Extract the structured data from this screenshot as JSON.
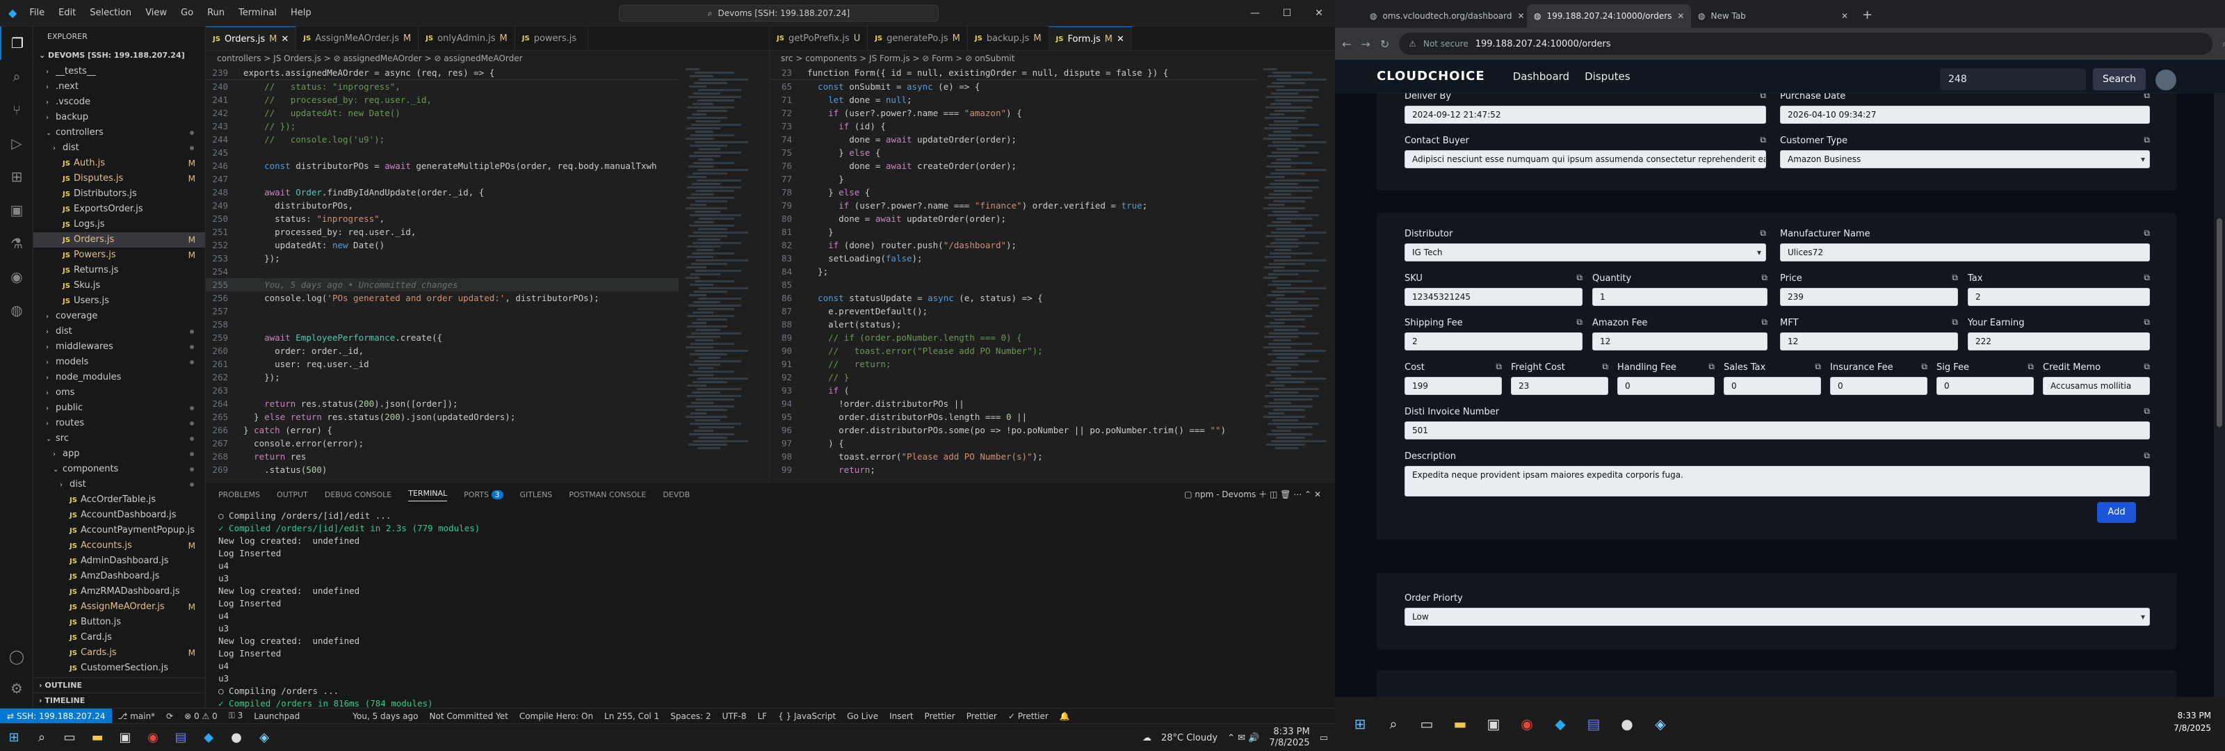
{
  "vscode": {
    "menu": [
      "File",
      "Edit",
      "Selection",
      "View",
      "Go",
      "Run",
      "Terminal",
      "Help"
    ],
    "command_center": "Devoms [SSH: 199.188.207.24]",
    "editor_tabs": [
      {
        "name": "Orders.js",
        "mark": "M",
        "active": true
      },
      {
        "name": "AssignMeAOrder.js",
        "mark": "M",
        "active": false
      },
      {
        "name": "onlyAdmin.js",
        "mark": "M",
        "active": false
      },
      {
        "name": "powers.js",
        "mark": "",
        "active": false
      }
    ],
    "editor2_tabs": [
      {
        "name": "getPoPrefix.js",
        "mark": "U",
        "active": false
      },
      {
        "name": "generatePo.js",
        "mark": "M",
        "active": false
      },
      {
        "name": "backup.js",
        "mark": "M",
        "active": false
      },
      {
        "name": "Form.js",
        "mark": "M",
        "active": true
      }
    ],
    "breadcrumb1": "controllers > JS Orders.js > ⊘ assignedMeAOrder > ⊘ assignedMeAOrder",
    "breadcrumb2": "src > components > JS Form.js > ⊘ Form > ⊘ onSubmit",
    "explorer_title": "EXPLORER",
    "explorer_root": "DEVOMS [SSH: 199.188.207.24]",
    "tree": [
      {
        "label": "__tests__",
        "depth": 1,
        "folder": true,
        "open": false,
        "badge": ""
      },
      {
        "label": ".next",
        "depth": 1,
        "folder": true,
        "open": false,
        "badge": ""
      },
      {
        "label": ".vscode",
        "depth": 1,
        "folder": true,
        "open": false,
        "badge": ""
      },
      {
        "label": "backup",
        "depth": 1,
        "folder": true,
        "open": false,
        "badge": ""
      },
      {
        "label": "controllers",
        "depth": 1,
        "folder": true,
        "open": true,
        "badge": "dot"
      },
      {
        "label": "dist",
        "depth": 2,
        "folder": true,
        "open": false,
        "badge": "dot"
      },
      {
        "label": "Auth.js",
        "depth": 2,
        "folder": false,
        "badge": "M"
      },
      {
        "label": "Disputes.js",
        "depth": 2,
        "folder": false,
        "badge": "M"
      },
      {
        "label": "Distributors.js",
        "depth": 2,
        "folder": false,
        "badge": ""
      },
      {
        "label": "ExportsOrder.js",
        "depth": 2,
        "folder": false,
        "badge": ""
      },
      {
        "label": "Logs.js",
        "depth": 2,
        "folder": false,
        "badge": ""
      },
      {
        "label": "Orders.js",
        "depth": 2,
        "folder": false,
        "badge": "M",
        "selected": true
      },
      {
        "label": "Powers.js",
        "depth": 2,
        "folder": false,
        "badge": "M"
      },
      {
        "label": "Returns.js",
        "depth": 2,
        "folder": false,
        "badge": ""
      },
      {
        "label": "Sku.js",
        "depth": 2,
        "folder": false,
        "badge": ""
      },
      {
        "label": "Users.js",
        "depth": 2,
        "folder": false,
        "badge": ""
      },
      {
        "label": "coverage",
        "depth": 1,
        "folder": true,
        "open": false,
        "badge": ""
      },
      {
        "label": "dist",
        "depth": 1,
        "folder": true,
        "open": false,
        "badge": "dot"
      },
      {
        "label": "middlewares",
        "depth": 1,
        "folder": true,
        "open": false,
        "badge": "dot"
      },
      {
        "label": "models",
        "depth": 1,
        "folder": true,
        "open": false,
        "badge": "dot"
      },
      {
        "label": "node_modules",
        "depth": 1,
        "folder": true,
        "open": false,
        "badge": ""
      },
      {
        "label": "oms",
        "depth": 1,
        "folder": true,
        "open": false,
        "badge": ""
      },
      {
        "label": "public",
        "depth": 1,
        "folder": true,
        "open": false,
        "badge": "dot"
      },
      {
        "label": "routes",
        "depth": 1,
        "folder": true,
        "open": false,
        "badge": "dot"
      },
      {
        "label": "src",
        "depth": 1,
        "folder": true,
        "open": true,
        "badge": "dot"
      },
      {
        "label": "app",
        "depth": 2,
        "folder": true,
        "open": false,
        "badge": "dot"
      },
      {
        "label": "components",
        "depth": 2,
        "folder": true,
        "open": true,
        "badge": "dot"
      },
      {
        "label": "dist",
        "depth": 3,
        "folder": true,
        "open": false,
        "badge": "dot"
      },
      {
        "label": "AccOrderTable.js",
        "depth": 3,
        "folder": false,
        "badge": ""
      },
      {
        "label": "AccountDashboard.js",
        "depth": 3,
        "folder": false,
        "badge": ""
      },
      {
        "label": "AccountPaymentPopup.js",
        "depth": 3,
        "folder": false,
        "badge": ""
      },
      {
        "label": "Accounts.js",
        "depth": 3,
        "folder": false,
        "badge": "M"
      },
      {
        "label": "AdminDashboard.js",
        "depth": 3,
        "folder": false,
        "badge": ""
      },
      {
        "label": "AmzDashboard.js",
        "depth": 3,
        "folder": false,
        "badge": ""
      },
      {
        "label": "AmzRMADashboard.js",
        "depth": 3,
        "folder": false,
        "badge": ""
      },
      {
        "label": "AssignMeAOrder.js",
        "depth": 3,
        "folder": false,
        "badge": "M"
      },
      {
        "label": "Button.js",
        "depth": 3,
        "folder": false,
        "badge": ""
      },
      {
        "label": "Card.js",
        "depth": 3,
        "folder": false,
        "badge": ""
      },
      {
        "label": "Cards.js",
        "depth": 3,
        "folder": false,
        "badge": "M"
      },
      {
        "label": "CustomerSection.js",
        "depth": 3,
        "folder": false,
        "badge": ""
      }
    ],
    "outline": "OUTLINE",
    "timeline": "TIMELINE",
    "code1": [
      {
        "n": "240",
        "t": "    //   status: \"inprogress\","
      },
      {
        "n": "241",
        "t": "    //   processed_by: req.user._id,"
      },
      {
        "n": "242",
        "t": "    //   updatedAt: new Date()"
      },
      {
        "n": "243",
        "t": "    // });"
      },
      {
        "n": "244",
        "t": "    //   console.log('u9');"
      },
      {
        "n": "245",
        "t": ""
      },
      {
        "n": "246",
        "t": "    const distributorPOs = await generateMultiplePOs(order, req.body.manualTxwh"
      },
      {
        "n": "247",
        "t": ""
      },
      {
        "n": "248",
        "t": "    await Order.findByIdAndUpdate(order._id, {"
      },
      {
        "n": "249",
        "t": "      distributorPOs,"
      },
      {
        "n": "250",
        "t": "      status: \"inprogress\","
      },
      {
        "n": "251",
        "t": "      processed_by: req.user._id,"
      },
      {
        "n": "252",
        "t": "      updatedAt: new Date()"
      },
      {
        "n": "253",
        "t": "    });"
      },
      {
        "n": "254",
        "t": ""
      },
      {
        "n": "255",
        "t": "    You, 5 days ago • Uncommitted changes"
      },
      {
        "n": "256",
        "t": "    console.log('POs generated and order updated:', distributorPOs);"
      },
      {
        "n": "257",
        "t": ""
      },
      {
        "n": "258",
        "t": ""
      },
      {
        "n": "259",
        "t": "    await EmployeePerformance.create({"
      },
      {
        "n": "260",
        "t": "      order: order._id,"
      },
      {
        "n": "261",
        "t": "      user: req.user._id"
      },
      {
        "n": "262",
        "t": "    });"
      },
      {
        "n": "263",
        "t": ""
      },
      {
        "n": "264",
        "t": "    return res.status(200).json([order]);"
      },
      {
        "n": "265",
        "t": "  } else return res.status(200).json(updatedOrders);"
      },
      {
        "n": "266",
        "t": "} catch (error) {"
      },
      {
        "n": "267",
        "t": "  console.error(error);"
      },
      {
        "n": "268",
        "t": "  return res"
      },
      {
        "n": "269",
        "t": "    .status(500)"
      }
    ],
    "code1_head": "exports.assignedMeAOrder = async (req, res) => {",
    "code2_head": "function Form({ id = null, existingOrder = null, dispute = false }) {",
    "code2": [
      {
        "n": "65",
        "t": "  const onSubmit = async (e) => {"
      },
      {
        "n": "71",
        "t": "    let done = null;"
      },
      {
        "n": "72",
        "t": "    if (user?.power?.name === \"amazon\") {"
      },
      {
        "n": "73",
        "t": "      if (id) {"
      },
      {
        "n": "74",
        "t": "        done = await updateOrder(order);"
      },
      {
        "n": "75",
        "t": "      } else {"
      },
      {
        "n": "76",
        "t": "        done = await createOrder(order);"
      },
      {
        "n": "77",
        "t": "      }"
      },
      {
        "n": "78",
        "t": "    } else {"
      },
      {
        "n": "79",
        "t": "      if (user?.power?.name === \"finance\") order.verified = true;"
      },
      {
        "n": "80",
        "t": "      done = await updateOrder(order);"
      },
      {
        "n": "81",
        "t": "    }"
      },
      {
        "n": "82",
        "t": "    if (done) router.push(\"/dashboard\");"
      },
      {
        "n": "83",
        "t": "    setLoading(false);"
      },
      {
        "n": "84",
        "t": "  };"
      },
      {
        "n": "85",
        "t": ""
      },
      {
        "n": "86",
        "t": "  const statusUpdate = async (e, status) => {"
      },
      {
        "n": "87",
        "t": "    e.preventDefault();"
      },
      {
        "n": "88",
        "t": "    alert(status);"
      },
      {
        "n": "89",
        "t": "    // if (order.poNumber.length === 0) {"
      },
      {
        "n": "90",
        "t": "    //   toast.error(\"Please add PO Number\");"
      },
      {
        "n": "91",
        "t": "    //   return;"
      },
      {
        "n": "92",
        "t": "    // }"
      },
      {
        "n": "93",
        "t": "    if ("
      },
      {
        "n": "94",
        "t": "      !order.distributorPOs ||"
      },
      {
        "n": "95",
        "t": "      order.distributorPOs.length === 0 ||"
      },
      {
        "n": "96",
        "t": "      order.distributorPOs.some(po => !po.poNumber || po.poNumber.trim() === \"\")"
      },
      {
        "n": "97",
        "t": "    ) {"
      },
      {
        "n": "98",
        "t": "      toast.error(\"Please add PO Number(s)\");"
      },
      {
        "n": "99",
        "t": "      return;"
      }
    ],
    "panel_tabs": [
      "PROBLEMS",
      "OUTPUT",
      "DEBUG CONSOLE",
      "TERMINAL",
      "PORTS",
      "GITLENS",
      "POSTMAN CONSOLE",
      "DEVDB"
    ],
    "ports_count": "3",
    "terminal_name": "npm - Devoms",
    "terminal": [
      "○ Compiling /orders/[id]/edit ...",
      "✓ Compiled /orders/[id]/edit in 2.3s (779 modules)",
      "New log created:  undefined",
      "Log Inserted",
      "u4",
      "u3",
      "New log created:  undefined",
      "Log Inserted",
      "u4",
      "u3",
      "New log created:  undefined",
      "Log Inserted",
      "u4",
      "u3",
      "○ Compiling /orders ...",
      "✓ Compiled /orders in 816ms (784 modules)"
    ],
    "status": {
      "remote": "⇄ SSH: 199.188.207.24",
      "branch": "⎇ main*",
      "sync": "⟳",
      "errors": "⊗ 0 ⚠ 0",
      "ports": "⚿ 3",
      "launchpad": "Launchpad",
      "blame": "You, 5 days ago",
      "not_committed": "Not Committed Yet",
      "compile_hero": "Compile Hero: On",
      "position": "Ln 255, Col 1",
      "spaces": "Spaces: 2",
      "encoding": "UTF-8",
      "eol": "LF",
      "language": "{ } JavaScript",
      "golive": "Go Live",
      "insert": "Insert",
      "prettier1": "Prettier",
      "prettier2": "Prettier",
      "prettier3": "✓ Prettier"
    },
    "taskbar": {
      "weather": "28°C  Cloudy",
      "time": "8:33 PM",
      "date": "7/8/2025"
    }
  },
  "browser": {
    "tabs": [
      {
        "title": "oms.vcloudtech.org/dashboard",
        "active": false
      },
      {
        "title": "199.188.207.24:10000/orders",
        "active": true
      },
      {
        "title": "New Tab",
        "active": false
      }
    ],
    "url_secure": "Not secure",
    "url": "199.188.207.24:10000/orders",
    "app": {
      "logo": "CLOUDCHOICE",
      "nav": [
        "Dashboard",
        "Disputes"
      ],
      "search_value": "248",
      "search_button": "Search"
    },
    "form": {
      "deliver_by_label": "Deliver By",
      "deliver_by": "2024-09-12 21:47:52",
      "purchase_date_label": "Purchase Date",
      "purchase_date": "2026-04-10 09:34:27",
      "contact_buyer_label": "Contact Buyer",
      "contact_buyer": "Adipisci nesciunt esse numquam qui ipsum assumenda consectetur reprehenderit ea.",
      "customer_type_label": "Customer Type",
      "customer_type": "Amazon Business",
      "distributor_label": "Distributor",
      "distributor": "IG Tech",
      "manufacturer_label": "Manufacturer Name",
      "manufacturer": "Ulices72",
      "sku_label": "SKU",
      "sku": "12345321245",
      "quantity_label": "Quantity",
      "quantity": "1",
      "price_label": "Price",
      "price": "239",
      "tax_label": "Tax",
      "tax": "2",
      "shipping_label": "Shipping Fee",
      "shipping": "2",
      "amazon_fee_label": "Amazon Fee",
      "amazon_fee": "12",
      "mft_label": "MFT",
      "mft": "12",
      "earning_label": "Your Earning",
      "earning": "222",
      "cost_label": "Cost",
      "cost": "199",
      "freight_label": "Freight Cost",
      "freight": "23",
      "handling_label": "Handling Fee",
      "handling": "0",
      "sales_tax_label": "Sales Tax",
      "sales_tax": "0",
      "insurance_label": "Insurance Fee",
      "insurance": "0",
      "sig_label": "Sig Fee",
      "sig": "0",
      "credit_memo_label": "Credit Memo",
      "credit_memo": "Accusamus mollitia",
      "invoice_label": "Disti Invoice Number",
      "invoice": "501",
      "description_label": "Description",
      "description": "Expedita neque provident ipsam maiores expedita corporis fuga.",
      "add_button": "Add",
      "priority_label": "Order Priorty",
      "priority": "Low"
    },
    "taskbar": {
      "time": "8:33 PM",
      "date": "7/8/2025"
    }
  },
  "colors": {
    "vscode_bg": "#1e1e1e",
    "accent": "#0078d4",
    "modified": "#e2c08d",
    "js_icon": "#e8d44d",
    "add_button": "#1a56db"
  }
}
